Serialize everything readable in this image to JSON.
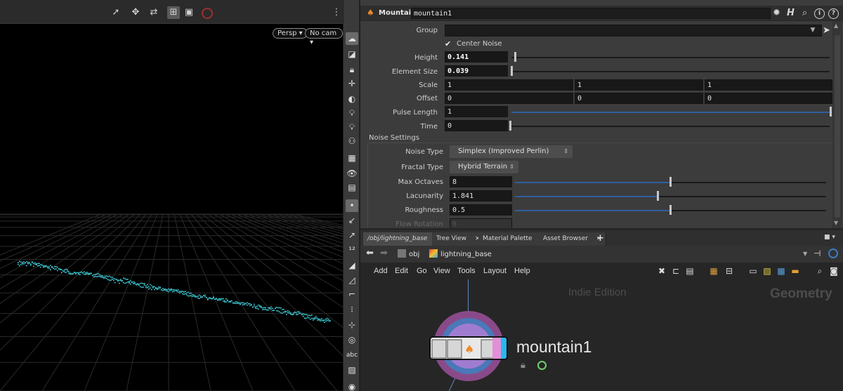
{
  "viewport": {
    "persp_label": "Persp",
    "cam_label": "No cam",
    "colors": {
      "background": "#000000",
      "grid": "#2a2a2a",
      "points": "#3fd6e0"
    }
  },
  "params": {
    "node_type": "Mountain",
    "node_name": "mountain1",
    "header_icons": [
      "gear-icon",
      "h-icon",
      "search-icon",
      "info-icon",
      "help-icon"
    ],
    "group": {
      "label": "Group",
      "value": ""
    },
    "center_noise": {
      "label": "Center Noise",
      "checked": true
    },
    "height": {
      "label": "Height",
      "value": "0.141",
      "slider_fraction": 0.01
    },
    "element_size": {
      "label": "Element Size",
      "value": "0.039",
      "slider_fraction": 0.0
    },
    "scale": {
      "label": "Scale",
      "values": [
        "1",
        "1",
        "1"
      ]
    },
    "offset": {
      "label": "Offset",
      "values": [
        "0",
        "0",
        "0"
      ]
    },
    "pulse_length": {
      "label": "Pulse Length",
      "value": "1",
      "slider_fraction": 1.0
    },
    "time": {
      "label": "Time",
      "value": "0",
      "slider_fraction": 0.0
    },
    "noise_settings": {
      "title": "Noise Settings",
      "noise_type": {
        "label": "Noise Type",
        "value": "Simplex (Improved Perlin)"
      },
      "fractal_type": {
        "label": "Fractal Type",
        "value": "Hybrid Terrain"
      },
      "max_octaves": {
        "label": "Max Octaves",
        "value": "8",
        "slider_fraction": 0.5
      },
      "lacunarity": {
        "label": "Lacunarity",
        "value": "1.841",
        "slider_fraction": 0.46
      },
      "roughness": {
        "label": "Roughness",
        "value": "0.5",
        "slider_fraction": 0.5
      },
      "flow_rotation": {
        "label": "Flow Rotation",
        "value": "0"
      }
    }
  },
  "network": {
    "tabs": [
      {
        "label": "/obj/lightning_base",
        "active": true
      },
      {
        "label": "Tree View",
        "active": false
      },
      {
        "label": "Material Palette",
        "active": false
      },
      {
        "label": "Asset Browser",
        "active": false
      }
    ],
    "path": {
      "obj": "obj",
      "node": "lightning_base"
    },
    "menu": [
      "Add",
      "Edit",
      "Go",
      "View",
      "Tools",
      "Layout",
      "Help"
    ],
    "watermark": "Indie Edition",
    "context_label": "Geometry",
    "node": {
      "name": "mountain1",
      "colors": {
        "outer": "#8a4a8a",
        "mid": "#4a78b8",
        "inner": "#a07cd0",
        "display_flag": "#28b7f0",
        "template_flag": "#e28fd8"
      }
    }
  }
}
